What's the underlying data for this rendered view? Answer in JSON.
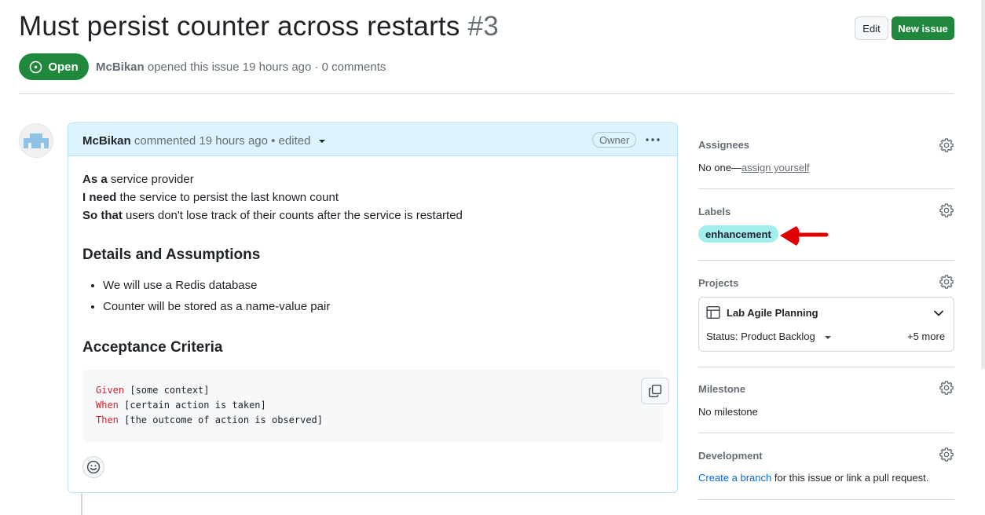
{
  "issue": {
    "title": "Must persist counter across restarts",
    "number": "#3",
    "status": "Open",
    "author": "McBikan",
    "opened_text": "opened this issue 19 hours ago · 0 comments"
  },
  "toolbar": {
    "edit_label": "Edit",
    "new_issue_label": "New issue"
  },
  "comment": {
    "author": "McBikan",
    "meta": "commented 19 hours ago • edited",
    "owner_badge": "Owner",
    "story": [
      {
        "bold": "As a",
        "rest": " service provider"
      },
      {
        "bold": "I need",
        "rest": " the service to persist the last known count"
      },
      {
        "bold": "So that",
        "rest": " users don't lose track of their counts after the service is restarted"
      }
    ],
    "details_heading": "Details and Assumptions",
    "bullets": [
      "We will use a Redis database",
      "Counter will be stored as a name-value pair"
    ],
    "acceptance_heading": "Acceptance Criteria",
    "code": [
      {
        "kw": "Given",
        "rest": " [some context]"
      },
      {
        "kw": "When",
        "rest": " [certain action is taken]"
      },
      {
        "kw": "Then",
        "rest": " [the outcome of action is observed]"
      }
    ]
  },
  "sidebar": {
    "assignees": {
      "heading": "Assignees",
      "prefix": "No one—",
      "link": "assign yourself"
    },
    "labels": {
      "heading": "Labels",
      "items": [
        "enhancement"
      ]
    },
    "projects": {
      "heading": "Projects",
      "name": "Lab Agile Planning",
      "status": "Status: Product Backlog",
      "more": "+5 more"
    },
    "milestone": {
      "heading": "Milestone",
      "value": "No milestone"
    },
    "development": {
      "heading": "Development",
      "link": "Create a branch",
      "rest": " for this issue or link a pull request."
    }
  },
  "colors": {
    "open_green": "#1f883d",
    "label_bg": "#a2eeef",
    "annotation_red": "#e00000",
    "comment_header": "#ddf4ff"
  },
  "icons": [
    "issue-opened-icon",
    "caret-down-icon",
    "kebab-icon",
    "copy-icon",
    "smiley-icon",
    "gear-icon",
    "table-icon",
    "chevron-down-icon",
    "red-arrow-annotation"
  ]
}
